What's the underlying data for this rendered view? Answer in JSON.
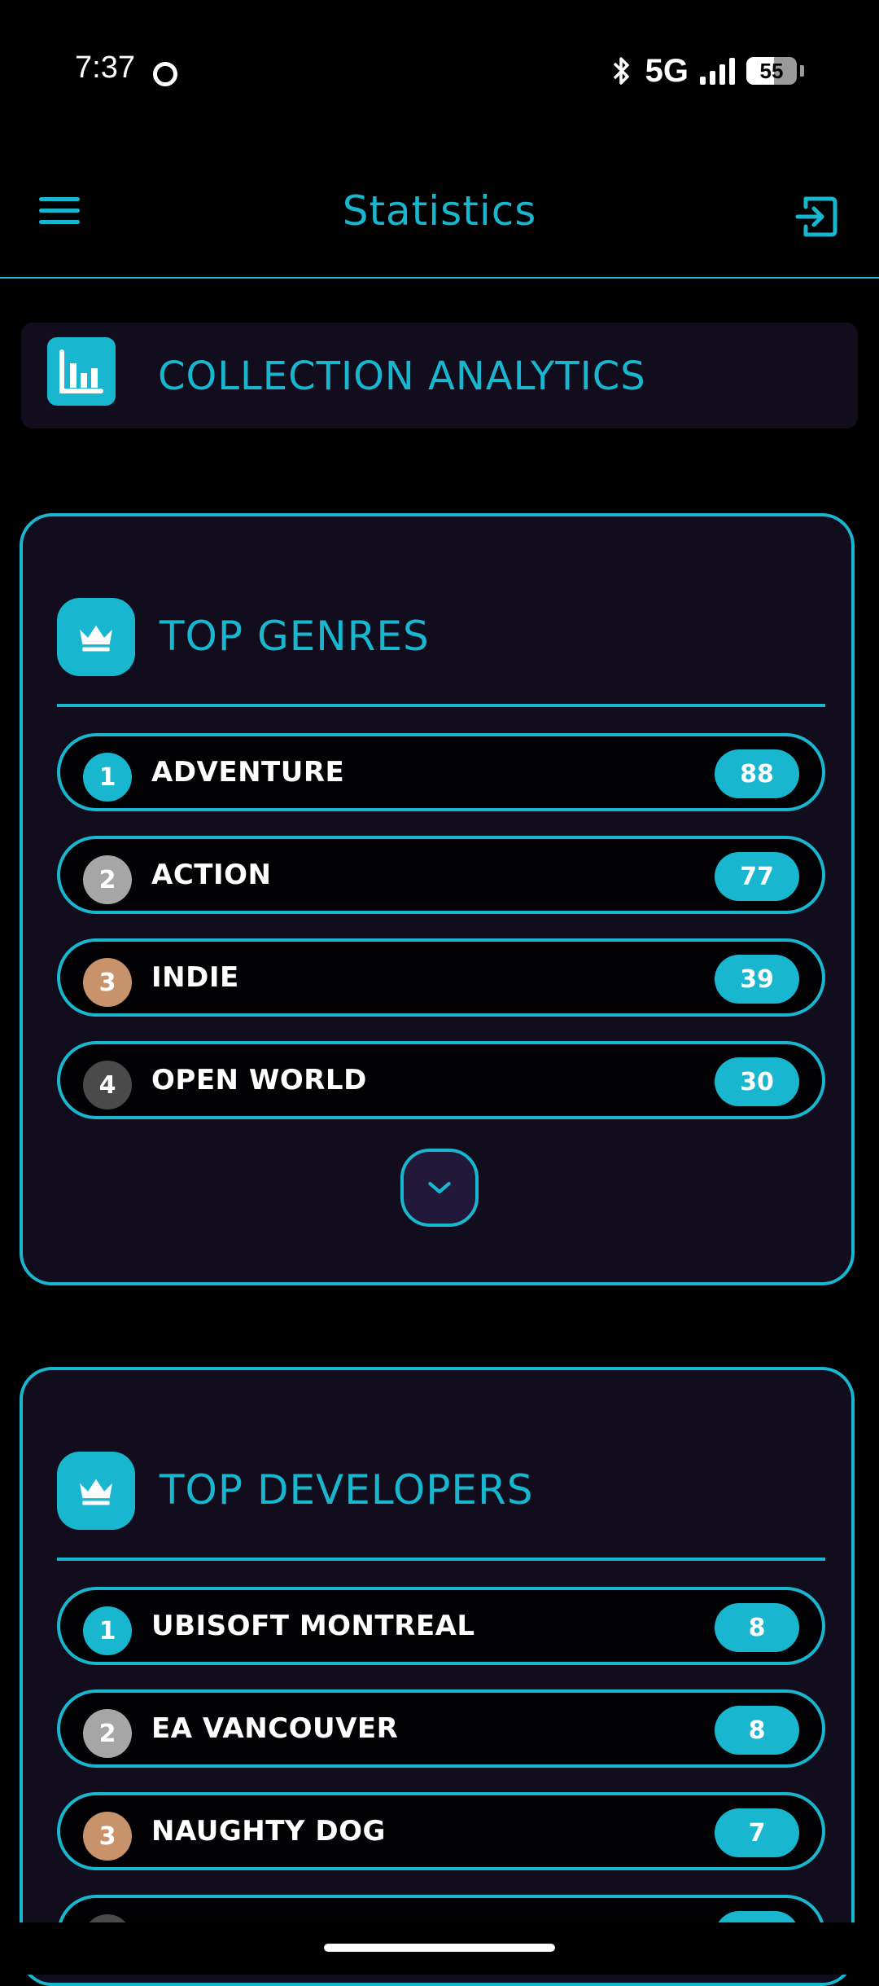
{
  "status_bar": {
    "time": "7:37",
    "network": "5G",
    "battery": "55",
    "battery_fraction": 0.55
  },
  "app_bar": {
    "title": "Statistics",
    "menu_icon": "hamburger-menu-icon",
    "logout_icon": "logout-icon"
  },
  "analytics": {
    "title": "COLLECTION ANALYTICS",
    "icon": "bar-chart-icon"
  },
  "colors": {
    "accent": "#19b6cf",
    "card_bg": "#110d1d",
    "rank_gold": "#19b6cf",
    "rank_silver": "#a6a6a6",
    "rank_bronze": "#c8936a",
    "rank_other": "#4a4a4a"
  },
  "genres": {
    "title": "TOP GENRES",
    "icon": "crown-icon",
    "items": [
      {
        "rank": "1",
        "name": "ADVENTURE",
        "count": "88"
      },
      {
        "rank": "2",
        "name": "ACTION",
        "count": "77"
      },
      {
        "rank": "3",
        "name": "INDIE",
        "count": "39"
      },
      {
        "rank": "4",
        "name": "OPEN WORLD",
        "count": "30"
      }
    ],
    "expand_icon": "chevron-down-icon"
  },
  "developers": {
    "title": "TOP DEVELOPERS",
    "icon": "crown-icon",
    "items": [
      {
        "rank": "1",
        "name": "UBISOFT MONTREAL",
        "count": "8"
      },
      {
        "rank": "2",
        "name": "EA VANCOUVER",
        "count": "8"
      },
      {
        "rank": "3",
        "name": "NAUGHTY DOG",
        "count": "7"
      }
    ]
  }
}
